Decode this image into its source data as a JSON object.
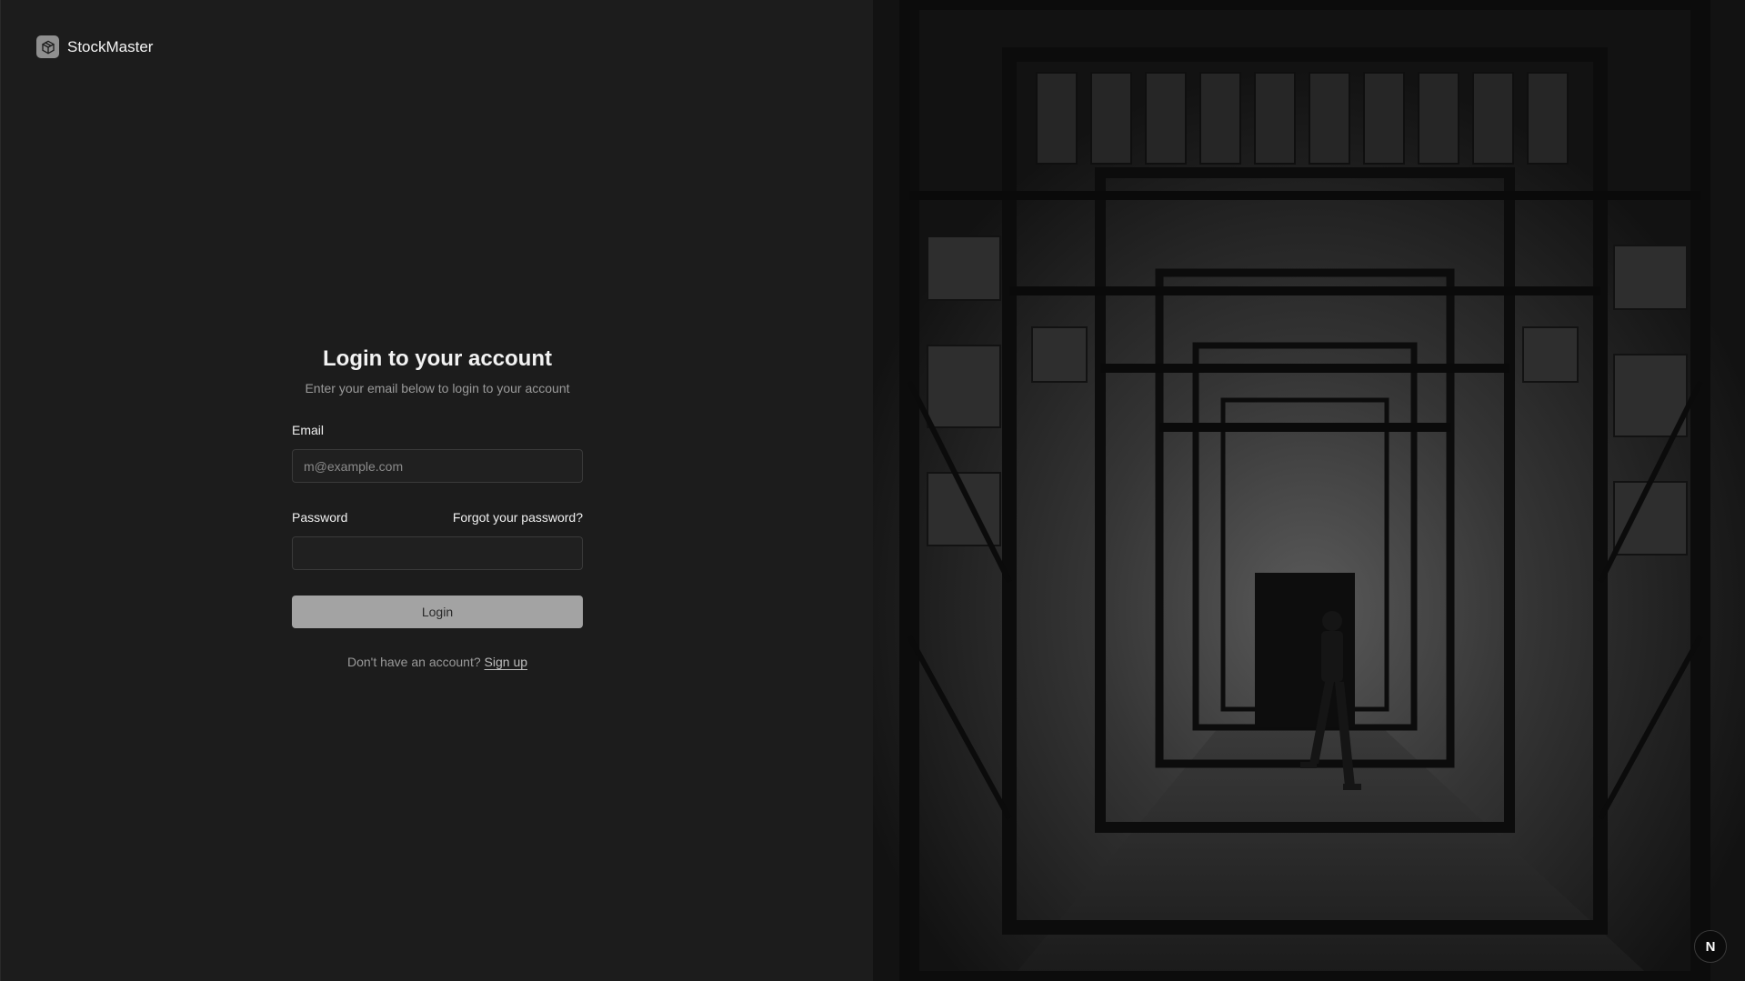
{
  "brand": {
    "name": "StockMaster",
    "icon": "package-box-icon"
  },
  "login": {
    "title": "Login to your account",
    "subtitle": "Enter your email below to login to your account",
    "email_label": "Email",
    "email_placeholder": "m@example.com",
    "email_value": "",
    "password_label": "Password",
    "password_value": "",
    "forgot_password": "Forgot your password?",
    "login_button": "Login",
    "signup_prompt": "Don't have an account?",
    "signup_link": "Sign up"
  },
  "dev_badge": {
    "label": "N",
    "icon": "nextjs-icon"
  },
  "colors": {
    "background": "#1c1c1c",
    "button": "#a3a3a3",
    "muted_text": "#9a9a9a"
  }
}
